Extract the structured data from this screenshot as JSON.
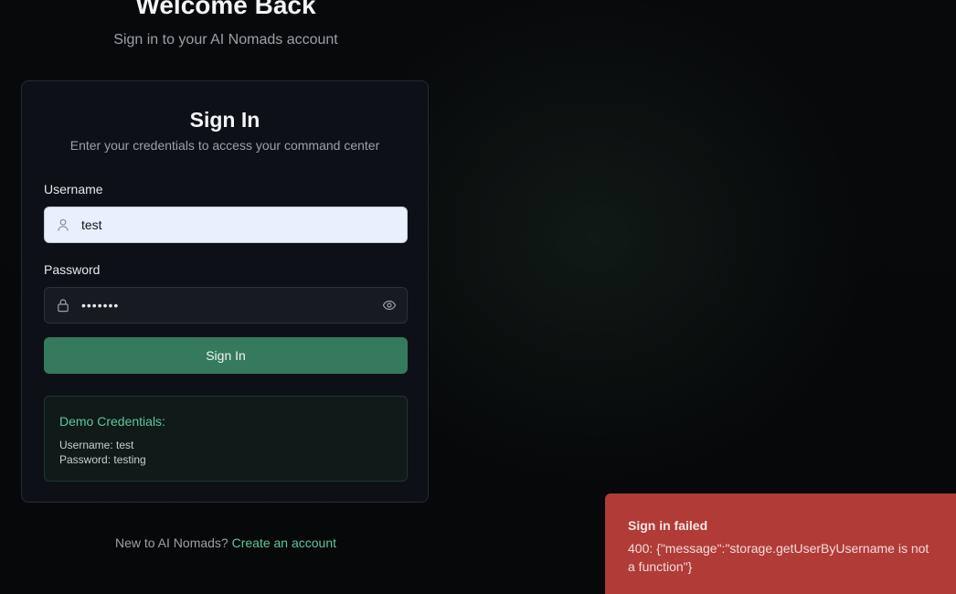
{
  "header": {
    "title": "Welcome Back",
    "subtitle": "Sign in to your AI Nomads account"
  },
  "card": {
    "title": "Sign In",
    "subtitle": "Enter your credentials to access your command center",
    "username": {
      "label": "Username",
      "value": "test",
      "icon": "user-icon"
    },
    "password": {
      "label": "Password",
      "masked_value": "•••••••",
      "icon": "lock-icon",
      "toggle_icon": "eye-icon"
    },
    "submit_label": "Sign In",
    "demo": {
      "title": "Demo Credentials:",
      "username_line": "Username: test",
      "password_line": "Password: testing"
    }
  },
  "footer": {
    "prompt": "New to AI Nomads?",
    "link": "Create an account"
  },
  "toast": {
    "title": "Sign in failed",
    "message": "400: {\"message\":\"storage.getUserByUsername is not a function\"}"
  },
  "colors": {
    "background": "#07090b",
    "card": "#0d1117",
    "accent": "#357a5c",
    "accent_text": "#5ec79a",
    "error": "#b13b37"
  }
}
